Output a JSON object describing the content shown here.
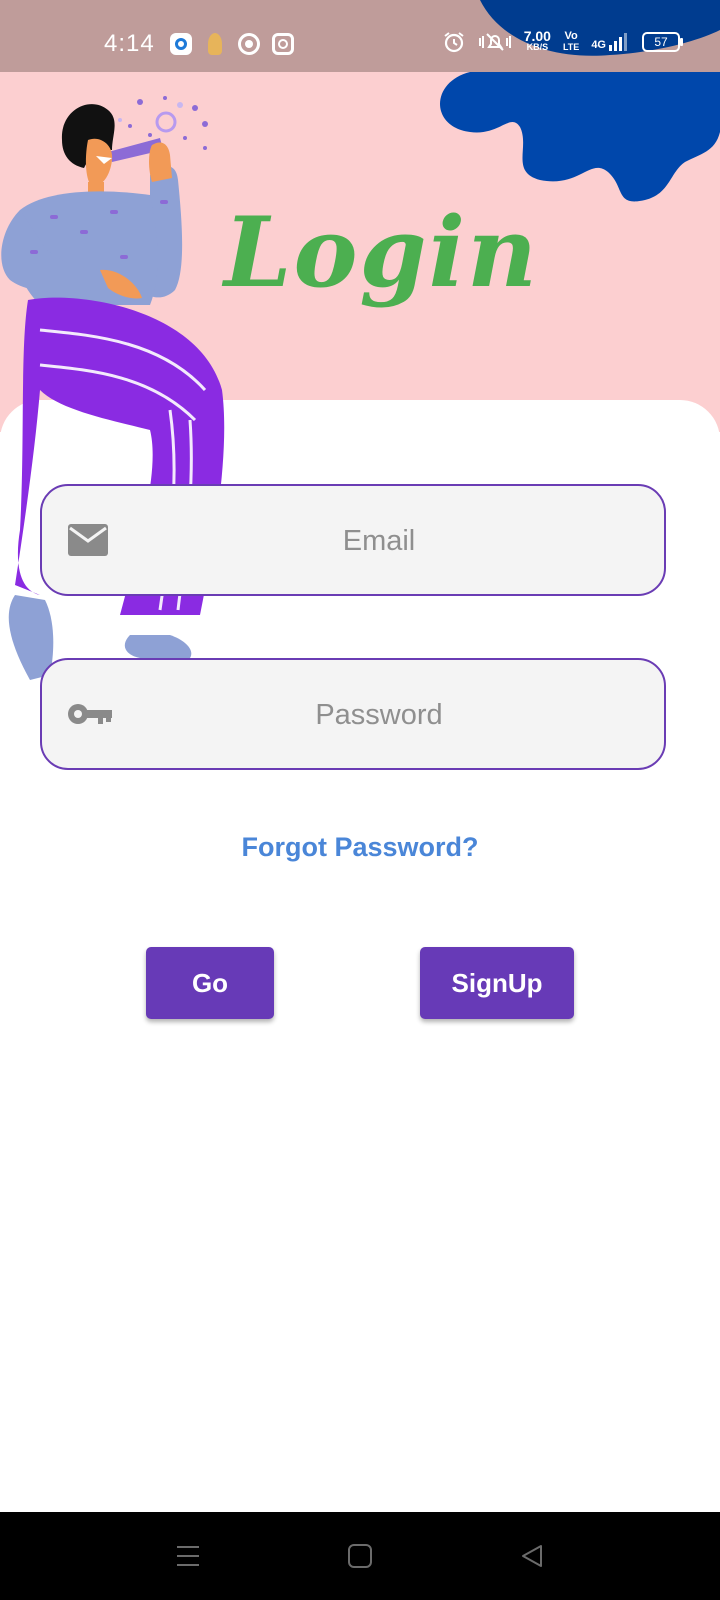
{
  "status_bar": {
    "time": "4:14",
    "net_speed_value": "7.00",
    "net_speed_unit": "KB/S",
    "volte_top": "Vo",
    "volte_bottom": "LTE",
    "network": "4G",
    "battery": "57",
    "icons": [
      "app-circle-icon",
      "app-character-icon",
      "chrome-icon",
      "instagram-icon",
      "alarm-icon",
      "mute-icon",
      "vibrate-icon",
      "signal-icon"
    ]
  },
  "header": {
    "title": "Login",
    "title_color": "#4caf50",
    "bg_color": "#fccfd0",
    "blob_color": "#0047ab"
  },
  "form": {
    "email": {
      "placeholder": "Email",
      "value": "",
      "icon": "mail-icon"
    },
    "password": {
      "placeholder": "Password",
      "value": "",
      "icon": "key-icon"
    },
    "forgot_label": "Forgot Password?",
    "go_label": "Go",
    "signup_label": "SignUp",
    "accent_color": "#673ab7",
    "link_color": "#4a86d8"
  },
  "nav_bar": {
    "items": [
      "menu-icon",
      "home-square-icon",
      "back-triangle-icon"
    ]
  }
}
